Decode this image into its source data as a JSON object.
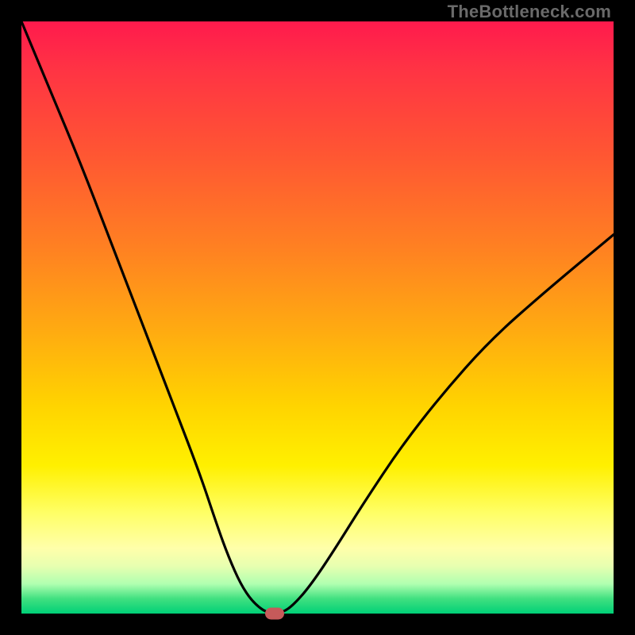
{
  "watermark": "TheBottleneck.com",
  "colors": {
    "frame": "#000000",
    "curve_stroke": "#000000",
    "marker": "#c65a5a"
  },
  "chart_data": {
    "type": "line",
    "title": "",
    "xlabel": "",
    "ylabel": "",
    "xlim": [
      0,
      100
    ],
    "ylim": [
      0,
      100
    ],
    "grid": false,
    "series": [
      {
        "name": "bottleneck-curve",
        "x": [
          0,
          5,
          10,
          15,
          20,
          25,
          30,
          33,
          35,
          37,
          39,
          41.5,
          44,
          46,
          49,
          53,
          58,
          64,
          71,
          79,
          88,
          100
        ],
        "y": [
          100,
          88,
          76,
          63,
          50,
          37,
          24,
          15,
          9.5,
          5,
          2,
          0,
          0.1,
          1.5,
          5,
          11,
          19,
          28,
          37,
          46,
          54,
          64
        ]
      }
    ],
    "marker": {
      "x": 42.8,
      "y": 0,
      "label": "optimal-point"
    },
    "gradient_stops": [
      {
        "pos": 0,
        "color": "#ff1a4d"
      },
      {
        "pos": 8,
        "color": "#ff3344"
      },
      {
        "pos": 22,
        "color": "#ff5533"
      },
      {
        "pos": 38,
        "color": "#ff8022"
      },
      {
        "pos": 52,
        "color": "#ffaa11"
      },
      {
        "pos": 65,
        "color": "#ffd400"
      },
      {
        "pos": 75,
        "color": "#fff000"
      },
      {
        "pos": 83,
        "color": "#ffff66"
      },
      {
        "pos": 89,
        "color": "#ffffaa"
      },
      {
        "pos": 92,
        "color": "#e7ffb0"
      },
      {
        "pos": 95,
        "color": "#b0ffb0"
      },
      {
        "pos": 97.5,
        "color": "#40e080"
      },
      {
        "pos": 100,
        "color": "#00d077"
      }
    ]
  }
}
